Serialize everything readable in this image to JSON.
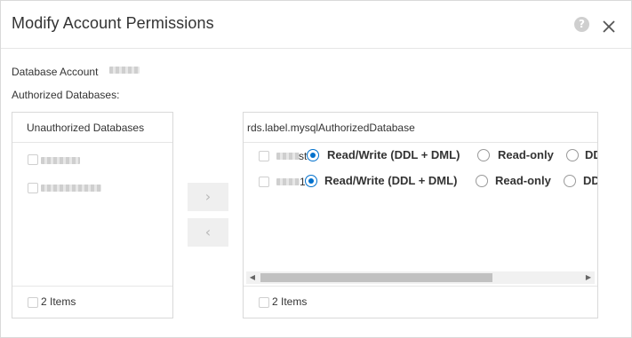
{
  "dialog": {
    "title": "Modify Account Permissions",
    "help_glyph": "?",
    "close_glyph": "×"
  },
  "form": {
    "account_label": "Database Account",
    "authorized_label": "Authorized Databases:"
  },
  "left_panel": {
    "title": "Unauthorized Databases",
    "footer": "2 Items"
  },
  "right_panel": {
    "title": "rds.label.mysqlAuthorizedDatabase",
    "footer": "2 Items",
    "rows": [
      {
        "name_suffix": "st",
        "options": [
          "Read/Write (DDL + DML)",
          "Read-only",
          "DD"
        ],
        "selected": 0
      },
      {
        "name_suffix": "1",
        "options": [
          "Read/Write (DDL + DML)",
          "Read-only",
          "DD"
        ],
        "selected": 0
      }
    ]
  },
  "transfer": {
    "right_glyph": "›",
    "left_glyph": "‹"
  },
  "scrollbar": {
    "left_glyph": "◀",
    "right_glyph": "▶"
  },
  "colors": {
    "accent": "#0070cc",
    "border": "#d9d9d9"
  }
}
